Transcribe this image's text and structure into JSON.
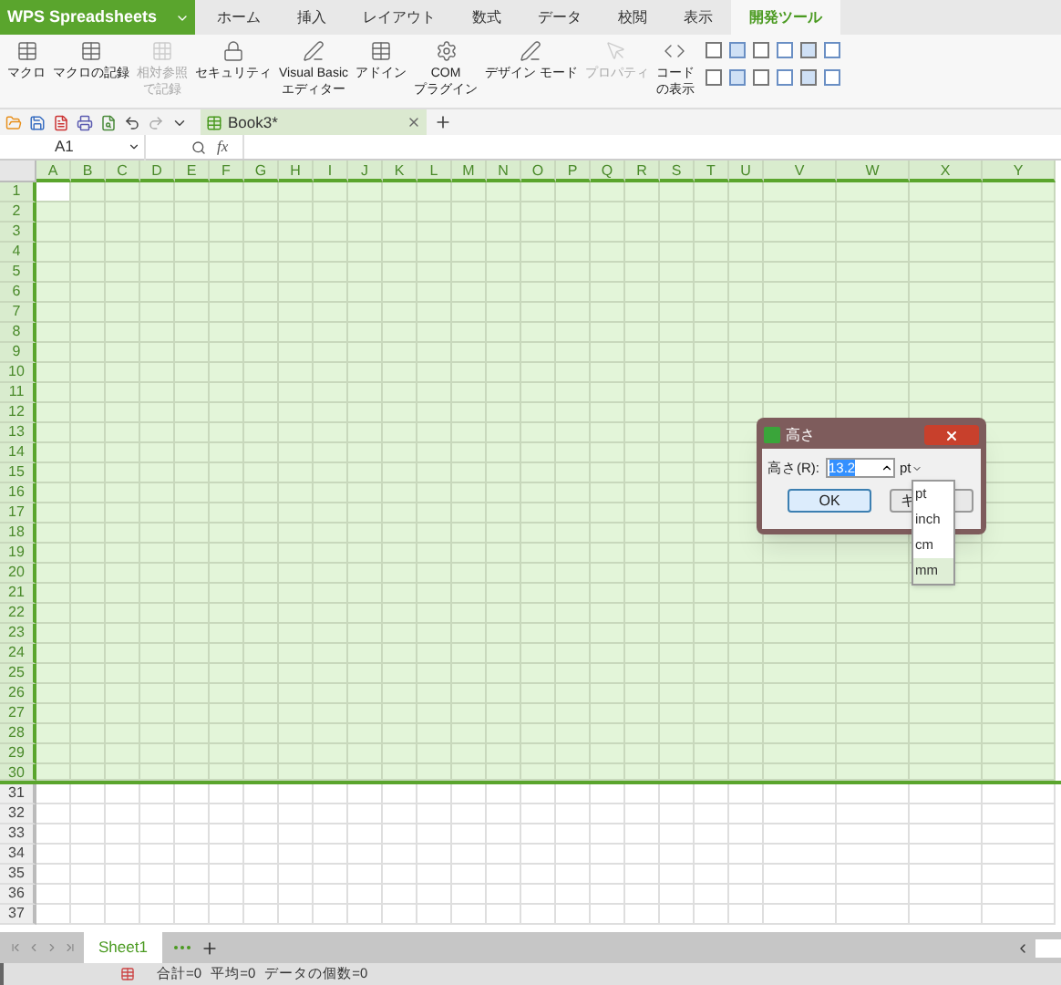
{
  "app_button": {
    "label": "WPS Spreadsheets"
  },
  "tabs": [
    {
      "label": "ホーム",
      "selected": false
    },
    {
      "label": "挿入",
      "selected": false
    },
    {
      "label": "レイアウト",
      "selected": false
    },
    {
      "label": "数式",
      "selected": false
    },
    {
      "label": "データ",
      "selected": false
    },
    {
      "label": "校閲",
      "selected": false
    },
    {
      "label": "表示",
      "selected": false
    },
    {
      "label": "開発ツール",
      "selected": true
    }
  ],
  "ribbon": [
    {
      "lines": [
        "マクロ"
      ],
      "disabled": false
    },
    {
      "lines": [
        "マクロの記録"
      ],
      "disabled": false
    },
    {
      "lines": [
        "相対参照",
        "で記録"
      ],
      "disabled": true
    },
    {
      "lines": [
        "セキュリティ"
      ],
      "disabled": false
    },
    {
      "lines": [
        "Visual Basic",
        "エディター"
      ],
      "disabled": false
    },
    {
      "lines": [
        "アドイン"
      ],
      "disabled": false
    },
    {
      "lines": [
        "COM",
        "プラグイン"
      ],
      "disabled": false
    },
    {
      "lines": [
        "デザイン モード"
      ],
      "disabled": false
    },
    {
      "lines": [
        "プロパティ"
      ],
      "disabled": true
    },
    {
      "lines": [
        "コード",
        "の表示"
      ],
      "disabled": false
    }
  ],
  "doc_tabs": [
    {
      "label": "Book3*",
      "selected": true
    }
  ],
  "formula_bar": {
    "name_box": "A1",
    "fx": "fx"
  },
  "columns": [
    {
      "label": "A",
      "selected": true
    },
    {
      "label": "B",
      "selected": true
    },
    {
      "label": "C",
      "selected": true
    },
    {
      "label": "D",
      "selected": true
    },
    {
      "label": "E",
      "selected": true
    },
    {
      "label": "F",
      "selected": true
    },
    {
      "label": "G",
      "selected": true
    },
    {
      "label": "H",
      "selected": true
    },
    {
      "label": "I",
      "selected": true
    },
    {
      "label": "J",
      "selected": true
    },
    {
      "label": "K",
      "selected": true
    },
    {
      "label": "L",
      "selected": true
    },
    {
      "label": "M",
      "selected": true
    },
    {
      "label": "N",
      "selected": true
    },
    {
      "label": "O",
      "selected": true
    },
    {
      "label": "P",
      "selected": true
    },
    {
      "label": "Q",
      "selected": true
    },
    {
      "label": "R",
      "selected": true
    },
    {
      "label": "S",
      "selected": true
    },
    {
      "label": "T",
      "selected": true
    },
    {
      "label": "U",
      "selected": true
    },
    {
      "label": "V",
      "selected": true
    },
    {
      "label": "W",
      "selected": true
    },
    {
      "label": "X",
      "selected": true
    },
    {
      "label": "Y",
      "selected": true
    }
  ],
  "rows": [
    {
      "label": "1",
      "selected": true,
      "active": true
    },
    {
      "label": "2",
      "selected": true,
      "active": false
    },
    {
      "label": "3",
      "selected": true,
      "active": false
    },
    {
      "label": "4",
      "selected": true,
      "active": false
    },
    {
      "label": "5",
      "selected": true,
      "active": false
    },
    {
      "label": "6",
      "selected": true,
      "active": false
    },
    {
      "label": "7",
      "selected": true,
      "active": false
    },
    {
      "label": "8",
      "selected": true,
      "active": false
    },
    {
      "label": "9",
      "selected": true,
      "active": false
    },
    {
      "label": "10",
      "selected": true,
      "active": false
    },
    {
      "label": "11",
      "selected": true,
      "active": false
    },
    {
      "label": "12",
      "selected": true,
      "active": false
    },
    {
      "label": "13",
      "selected": true,
      "active": false
    },
    {
      "label": "14",
      "selected": true,
      "active": false
    },
    {
      "label": "15",
      "selected": true,
      "active": false
    },
    {
      "label": "16",
      "selected": true,
      "active": false
    },
    {
      "label": "17",
      "selected": true,
      "active": false
    },
    {
      "label": "18",
      "selected": true,
      "active": false
    },
    {
      "label": "19",
      "selected": true,
      "active": false
    },
    {
      "label": "20",
      "selected": true,
      "active": false
    },
    {
      "label": "21",
      "selected": true,
      "active": false
    },
    {
      "label": "22",
      "selected": true,
      "active": false
    },
    {
      "label": "23",
      "selected": true,
      "active": false
    },
    {
      "label": "24",
      "selected": true,
      "active": false
    },
    {
      "label": "25",
      "selected": true,
      "active": false
    },
    {
      "label": "26",
      "selected": true,
      "active": false
    },
    {
      "label": "27",
      "selected": true,
      "active": false
    },
    {
      "label": "28",
      "selected": true,
      "active": false
    },
    {
      "label": "29",
      "selected": true,
      "active": false
    },
    {
      "label": "30",
      "selected": true,
      "active": false
    },
    {
      "label": "31",
      "selected": false,
      "active": false
    },
    {
      "label": "32",
      "selected": false,
      "active": false
    },
    {
      "label": "33",
      "selected": false,
      "active": false
    },
    {
      "label": "34",
      "selected": false,
      "active": false
    },
    {
      "label": "35",
      "selected": false,
      "active": false
    },
    {
      "label": "36",
      "selected": false,
      "active": false
    },
    {
      "label": "37",
      "selected": false,
      "active": false
    }
  ],
  "dialog": {
    "title": "高さ",
    "field_label": "高さ(R):",
    "value": "13.2",
    "unit": "pt",
    "buttons": [
      "OK",
      "キ"
    ],
    "unit_options": [
      {
        "label": "pt",
        "selected": false
      },
      {
        "label": "inch",
        "selected": false
      },
      {
        "label": "cm",
        "selected": false
      },
      {
        "label": "mm",
        "selected": true
      }
    ]
  },
  "sheet_tabs": [
    {
      "label": "Sheet1",
      "selected": true
    }
  ],
  "status_bar": [
    "合計=0",
    "平均=0",
    "データの個数=0"
  ]
}
